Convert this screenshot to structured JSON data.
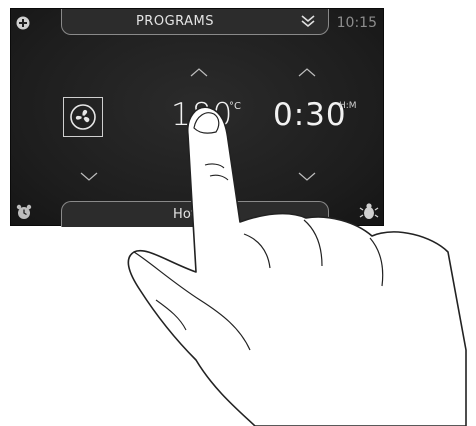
{
  "header": {
    "title": "PROGRAMS",
    "time": "10:15"
  },
  "temperature": {
    "value": "180",
    "unit": "°C"
  },
  "duration": {
    "value": "0:30",
    "unit": "H:M"
  },
  "mode": {
    "label": "Hot air"
  },
  "icons": {
    "top_left": "plus-icon",
    "header_toggle": "double-chevron-down-icon",
    "function": "fan-icon",
    "bottom_left": "alarm-clock-icon",
    "bottom_right": "bug-icon"
  }
}
